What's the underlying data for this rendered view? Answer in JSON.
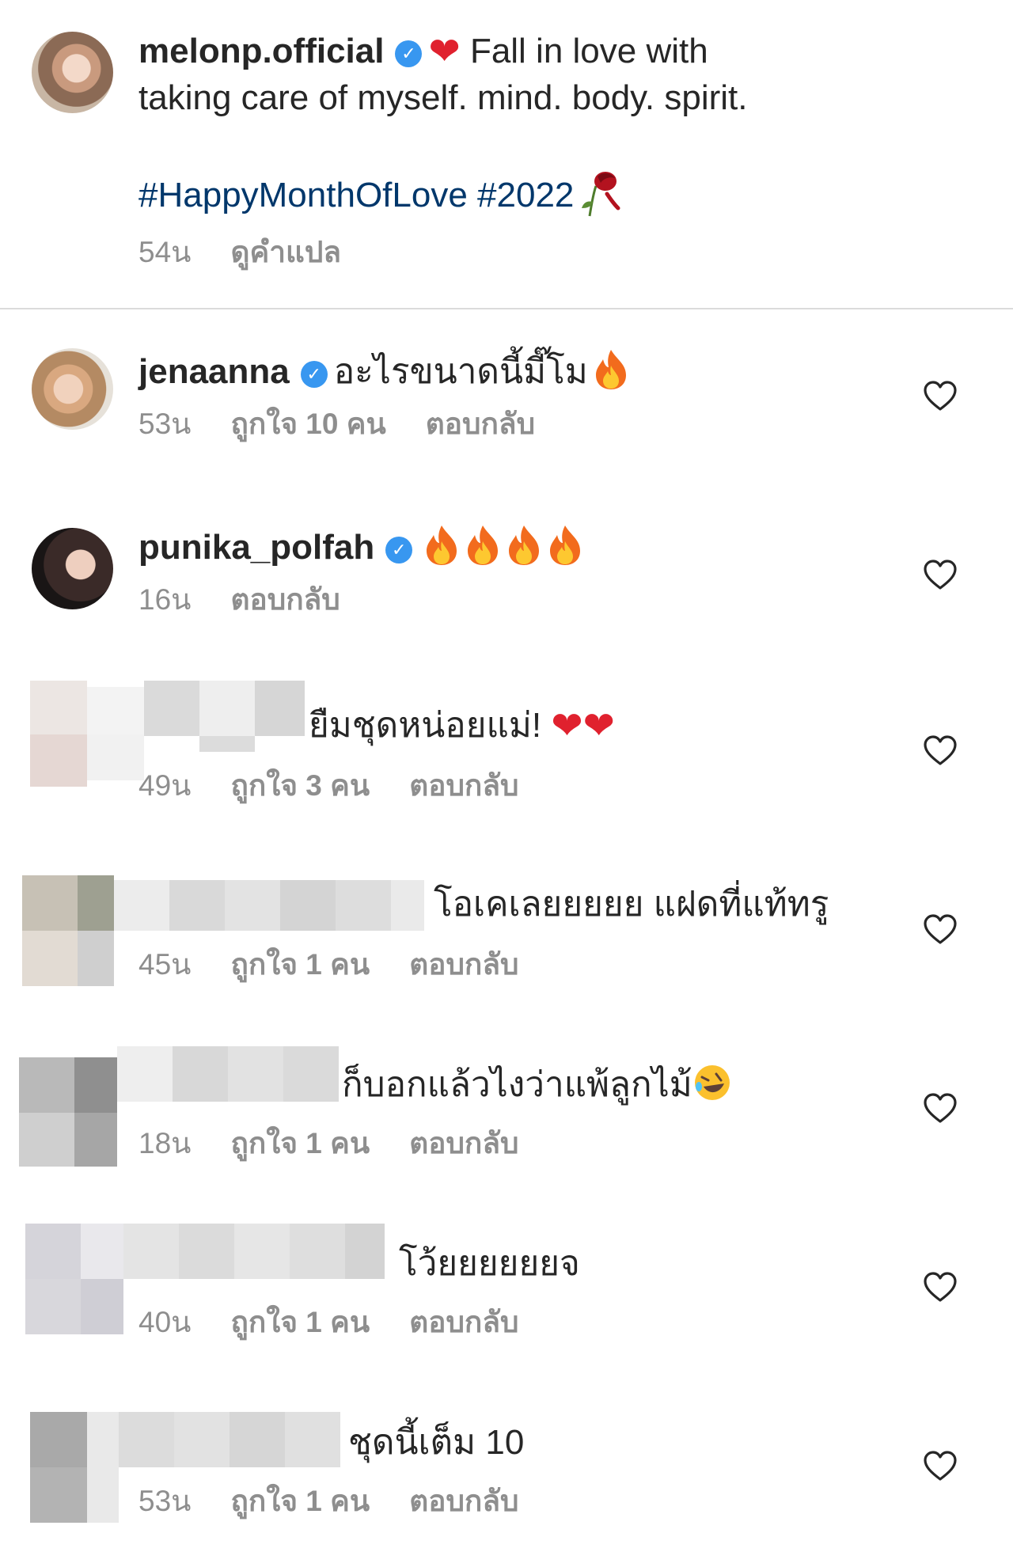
{
  "caption": {
    "username": "melonp.official",
    "text_line1": "Fall in love with",
    "text_line2": "taking care of myself. mind. body. spirit.",
    "hashtags": "#HappyMonthOfLove #2022",
    "time": "54น",
    "translate": "ดูคำแปล"
  },
  "comments": [
    {
      "username": "jenaanna",
      "text": "อะไรขนาดนี้มี๊โม",
      "time": "53น",
      "likes": "ถูกใจ 10 คน",
      "reply": "ตอบกลับ"
    },
    {
      "username": "punika_polfah",
      "text": "",
      "time": "16น",
      "likes": "",
      "reply": "ตอบกลับ"
    },
    {
      "username": "",
      "text": "ยืมชุดหน่อยแม่!",
      "time": "49น",
      "likes": "ถูกใจ 3 คน",
      "reply": "ตอบกลับ"
    },
    {
      "username": "",
      "text": "โอเคเลยยยยย แฝดที่แท้ทรู",
      "time": "45น",
      "likes": "ถูกใจ 1 คน",
      "reply": "ตอบกลับ"
    },
    {
      "username": "",
      "text": "ก็บอกแล้วไงว่าแพ้ลูกไม้",
      "time": "18น",
      "likes": "ถูกใจ 1 คน",
      "reply": "ตอบกลับ"
    },
    {
      "username": "",
      "text": "โว้ยยยยยยจ",
      "time": "40น",
      "likes": "ถูกใจ 1 คน",
      "reply": "ตอบกลับ"
    },
    {
      "username": "",
      "text": "ชุดนี้เต็ม 10",
      "time": "53น",
      "likes": "ถูกใจ 1 คน",
      "reply": "ตอบกลับ"
    }
  ],
  "icons": {
    "verified": "✓",
    "heart_emoji": "❤",
    "like": "heart-outline-icon"
  },
  "colors": {
    "text": "#262626",
    "meta": "#8e8e8e",
    "hashtag": "#00376b",
    "verified": "#3897f0",
    "heart": "#e0212e"
  }
}
